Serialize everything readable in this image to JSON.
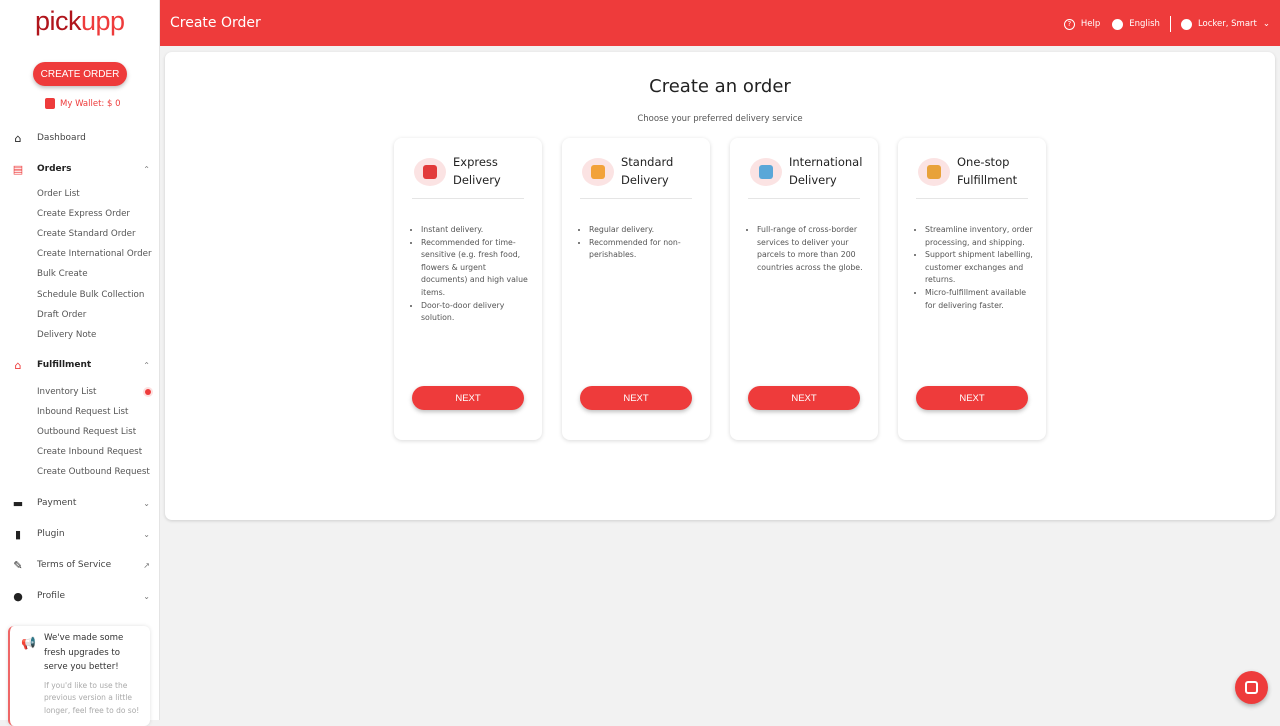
{
  "sidebar": {
    "logo_a": "pick",
    "logo_b": "upp",
    "create_order": "CREATE ORDER",
    "wallet": "My Wallet: $ 0",
    "dashboard": "Dashboard",
    "orders": "Orders",
    "orders_items": [
      "Order List",
      "Create Express Order",
      "Create Standard Order",
      "Create International Order",
      "Bulk Create",
      "Schedule Bulk Collection",
      "Draft Order",
      "Delivery Note"
    ],
    "fulfillment": "Fulfillment",
    "fulfillment_items": [
      "Inventory List",
      "Inbound Request List",
      "Outbound Request List",
      "Create Inbound Request",
      "Create Outbound Request"
    ],
    "payment": "Payment",
    "plugin": "Plugin",
    "terms": "Terms of Service",
    "profile": "Profile",
    "notice": {
      "title": "We've made some fresh upgrades to serve you better!",
      "body": "If you'd like to use the previous version a little longer, feel free to do so!"
    }
  },
  "header": {
    "title": "Create Order",
    "help": "Help",
    "language": "English",
    "user": "Locker, Smart"
  },
  "main": {
    "title": "Create an order",
    "subtitle": "Choose your preferred delivery service",
    "cards": [
      {
        "title": "Express Delivery",
        "icon": "express-delivery-icon",
        "bullets": [
          "Instant delivery.",
          "Recommended for time-sensitive (e.g. fresh food, flowers & urgent documents) and high value items.",
          "Door-to-door delivery solution."
        ],
        "button": "NEXT"
      },
      {
        "title": "Standard Delivery",
        "icon": "standard-delivery-icon",
        "bullets": [
          "Regular delivery.",
          "Recommended for non-perishables."
        ],
        "button": "NEXT"
      },
      {
        "title": "International Delivery",
        "icon": "international-delivery-icon",
        "bullets": [
          "Full-range of cross-border services to deliver your parcels to more than 200 countries across the globe."
        ],
        "button": "NEXT"
      },
      {
        "title": "One-stop Fulfillment",
        "icon": "fulfillment-icon",
        "bullets": [
          "Streamline inventory, order processing, and shipping.",
          "Support shipment labelling, customer exchanges and returns.",
          "Micro-fulfillment available for delivering faster."
        ],
        "button": "NEXT"
      }
    ]
  },
  "colors": {
    "brand": "#ee3b3b",
    "logo_dark": "#b0141b"
  }
}
